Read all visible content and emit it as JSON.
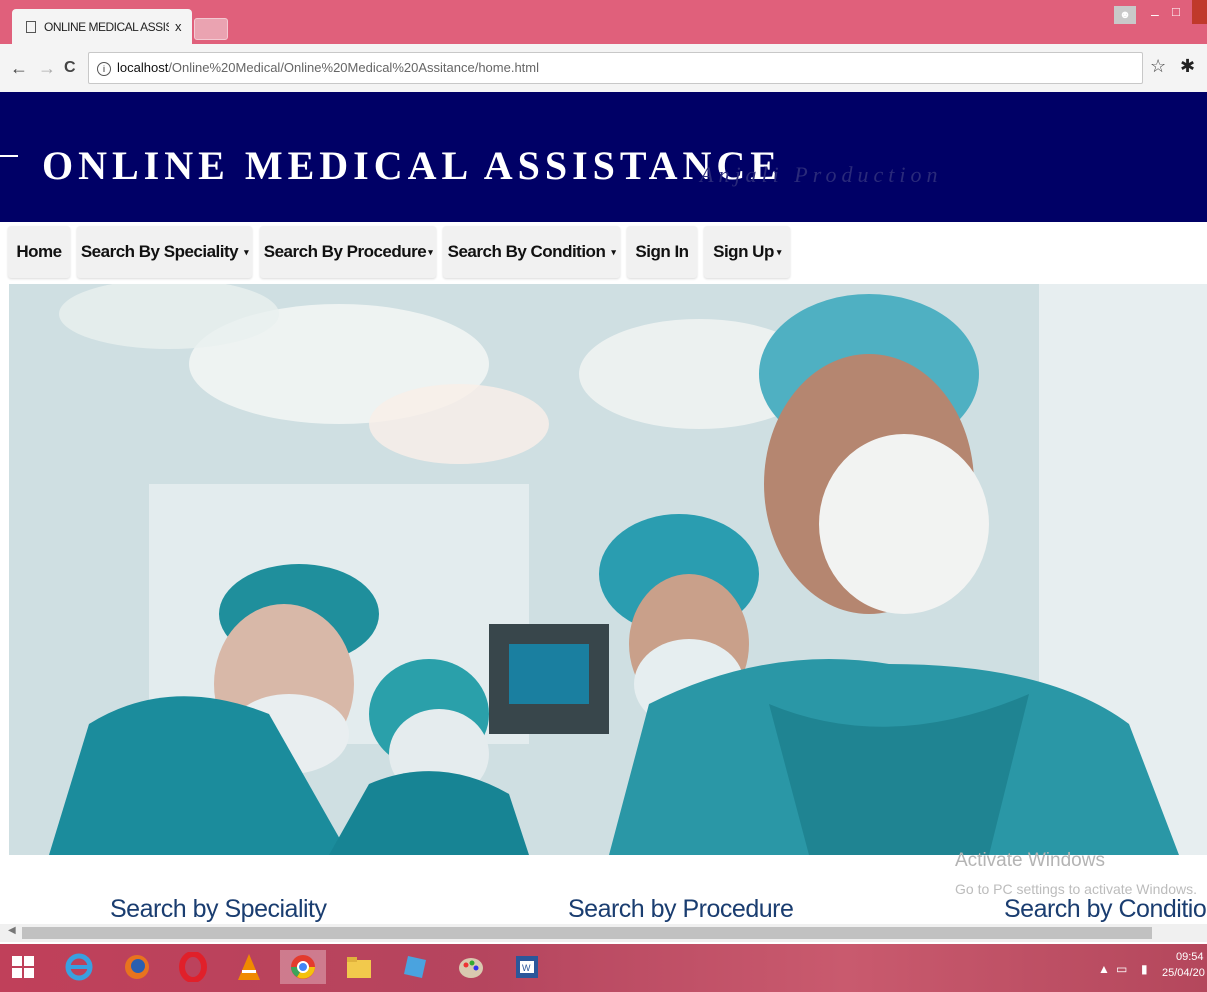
{
  "browser": {
    "tab_title": "ONLINE MEDICAL ASSIST",
    "tab_close": "x",
    "url_host": "localhost",
    "url_path": "/Online%20Medical/Online%20Medical%20Assitance/home.html",
    "back_icon": "←",
    "forward_icon": "→",
    "reload_icon": "C",
    "info_icon": "i",
    "star_icon": "☆",
    "extension_icon": "✱"
  },
  "header": {
    "title": "ONLINE MEDICAL ASSISTANCE",
    "subtitle": "Anjali Production",
    "background": "#000066"
  },
  "nav": {
    "items": [
      {
        "label": "Home",
        "caret": ""
      },
      {
        "label": "Search By Speciality",
        "caret": "▾"
      },
      {
        "label": "Search By Procedure",
        "caret": "▾"
      },
      {
        "label": "Search By Condition",
        "caret": "▾"
      },
      {
        "label": "Sign In",
        "caret": ""
      },
      {
        "label": "Sign Up",
        "caret": "▾"
      }
    ]
  },
  "sections": {
    "speciality": "Search by Speciality",
    "procedure": "Search by Procedure",
    "condition": "Search by Condition"
  },
  "watermark": {
    "line1": "Activate Windows",
    "line2": "Go to PC settings to activate Windows."
  },
  "taskbar": {
    "time": "09:54",
    "date": "25/04/20",
    "tray_up": "▲"
  }
}
